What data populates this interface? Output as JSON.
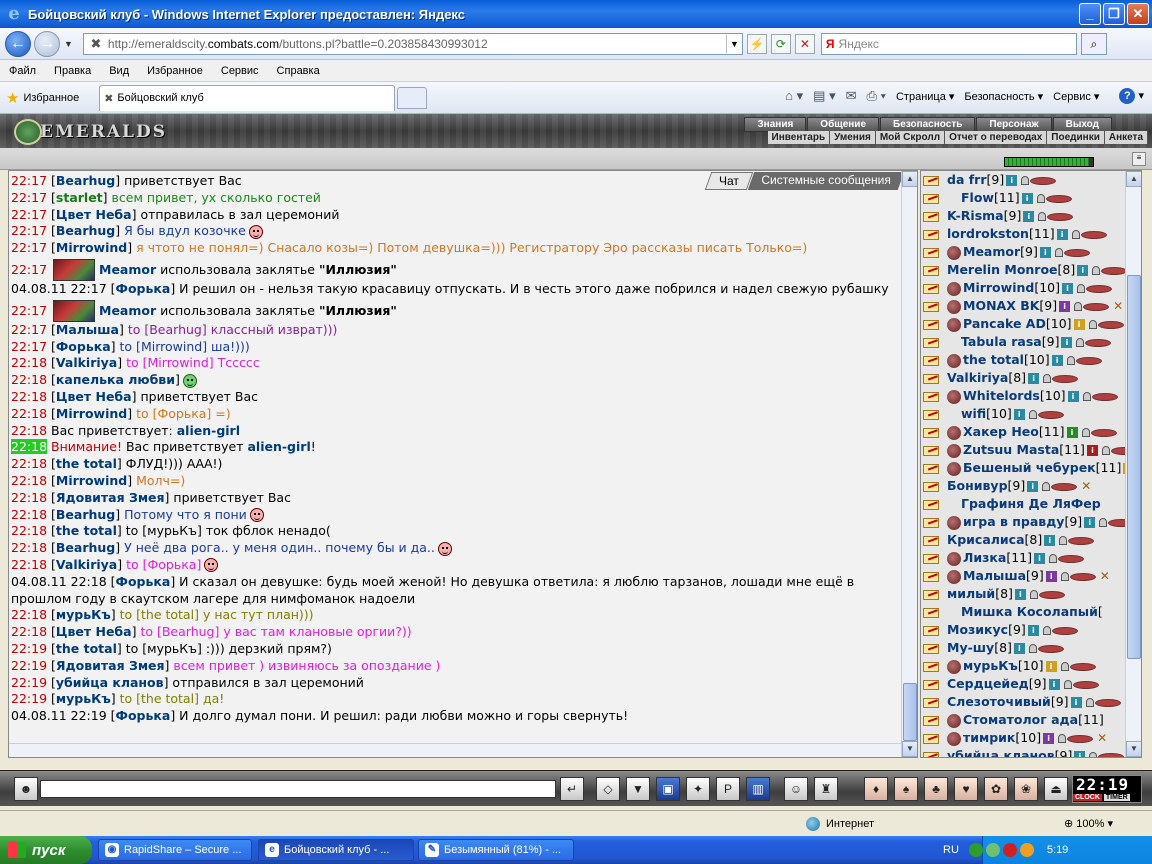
{
  "window": {
    "title": "Бойцовский клуб - Windows Internet Explorer предоставлен: Яндекс"
  },
  "address": {
    "url_prefix": "http://emeraldscity.",
    "url_domain": "combats.com",
    "url_suffix": "/buttons.pl?battle=0.203858430993012",
    "search_placeholder": "Яндекс"
  },
  "menu": [
    "Файл",
    "Правка",
    "Вид",
    "Избранное",
    "Сервис",
    "Справка"
  ],
  "favorites": {
    "label": "Избранное",
    "tab_title": "Бойцовский клуб"
  },
  "command_bar": {
    "page": "Страница ▾",
    "security": "Безопасность ▾",
    "service": "Сервис ▾"
  },
  "game": {
    "logo": "EMERALDS",
    "top_menu": [
      "Знания",
      "Общение",
      "Безопасность",
      "Персонаж",
      "Выход"
    ],
    "sub_menu": [
      "Инвентарь",
      "Умения",
      "Мой Скролл",
      "Отчет о переводах",
      "Поединки",
      "Анкета"
    ],
    "hp_percent": 95
  },
  "chat": {
    "tabs": [
      "Чат",
      "Системные сообщения"
    ],
    "lines": [
      {
        "time": "22:17",
        "nick": "Bearhug",
        "text": " приветствует Вас",
        "style": "plain",
        "type": "greet"
      },
      {
        "time": "22:17",
        "nick": "starlet",
        "text": " всем привет, ух сколько гостей",
        "style": "green",
        "type": "nick"
      },
      {
        "time": "22:17",
        "nick": "Цвет Неба",
        "text": " отправилась в зал церемоний",
        "style": "plain",
        "type": "greet"
      },
      {
        "time": "22:17",
        "nick": "Bearhug",
        "text": " Я бы вдул козочке",
        "style": "blue",
        "type": "nick",
        "smile": "pink"
      },
      {
        "time": "22:17",
        "nick": "Mirrowind",
        "text": " я чтото не понял=) Снасало козы=) Потом девушка=))) Регистратору Эро рассказы писать Только=)",
        "style": "orange",
        "type": "nick"
      },
      {
        "time": "22:17",
        "nick": "Meamor",
        "text": " использовала заклятье ",
        "bold": "\"Иллюзия\"",
        "type": "spell"
      },
      {
        "time": "04.08.11 22:17",
        "nick": "Форька",
        "text": " И решил он - нельзя такую красавицу отпускать. И в честь этого даже побрился и надел свежую рубашку",
        "style": "plain",
        "type": "wrap"
      },
      {
        "time": "22:17",
        "nick": "Meamor",
        "text": " использовала заклятье ",
        "bold": "\"Иллюзия\"",
        "type": "spell"
      },
      {
        "time": "22:17",
        "nick": "Малыша",
        "to": "Bearhug",
        "text": " классный изврат)))",
        "style": "violet",
        "type": "to"
      },
      {
        "time": "22:17",
        "nick": "Форька",
        "to": "Mirrowind",
        "text": " ша!)))",
        "style": "blue",
        "type": "to"
      },
      {
        "time": "22:18",
        "nick": "Valkiriya",
        "to": "Mirrowind",
        "text": " Тссссс",
        "style": "magenta",
        "type": "to"
      },
      {
        "time": "22:18",
        "nick": "капелька любви",
        "text": "",
        "style": "plain",
        "type": "nick",
        "smile": "green"
      },
      {
        "time": "22:18",
        "nick": "Цвет Неба",
        "text": " приветствует Вас",
        "style": "plain",
        "type": "greet"
      },
      {
        "time": "22:18",
        "nick": "Mirrowind",
        "to": "Форька",
        "text": " =)",
        "style": "orange",
        "type": "to"
      },
      {
        "time": "22:18",
        "prefix": "Вас приветствует: ",
        "name": "alien-girl",
        "type": "sys"
      },
      {
        "time": "22:18",
        "warn": "Внимание!",
        "prefix": " Вас приветствует ",
        "name": "alien-girl",
        "suffix": "!",
        "type": "warn"
      },
      {
        "time": "22:18",
        "nick": "the total",
        "text": " ФЛУД!))) ААА!)",
        "style": "plain",
        "type": "nick"
      },
      {
        "time": "22:18",
        "nick": "Mirrowind",
        "text": " Молч=)",
        "style": "orange",
        "type": "nick"
      },
      {
        "time": "22:18",
        "nick": "Ядовитая Змея",
        "text": " приветствует Вас",
        "style": "plain",
        "type": "greet"
      },
      {
        "time": "22:18",
        "nick": "Bearhug",
        "text": " Потому что я пони",
        "style": "blue",
        "type": "nick",
        "smile": "pink"
      },
      {
        "time": "22:18",
        "nick": "the total",
        "to": "мурьКъ",
        "text": " ток фблок ненадо(",
        "style": "plain",
        "type": "to"
      },
      {
        "time": "22:18",
        "nick": "Bearhug",
        "text": " У неё два рога.. у меня один.. почему бы и да..",
        "style": "blue",
        "type": "nick",
        "smile": "pink"
      },
      {
        "time": "22:18",
        "nick": "Valkiriya",
        "to": "Форька",
        "text": "",
        "style": "magenta",
        "type": "to",
        "smile": "pink"
      },
      {
        "time": "04.08.11 22:18",
        "nick": "Форька",
        "text": " И сказал он девушке: будь моей женой! Но девушка ответила: я люблю тарзанов, лошади мне ещё в прошлом году в скаутском лагере для нимфоманок надоели",
        "style": "plain",
        "type": "wrap"
      },
      {
        "time": "22:18",
        "nick": "мурьКъ",
        "to": "the total",
        "text": " у нас тут план)))",
        "style": "olive",
        "type": "to"
      },
      {
        "time": "22:18",
        "nick": "Цвет Неба",
        "to": "Bearhug",
        "text": " у вас там клановые оргии?))",
        "style": "magenta",
        "type": "to"
      },
      {
        "time": "22:19",
        "nick": "the total",
        "to": "мурьКъ",
        "text": " :))) дерзкий прям?)",
        "style": "plain",
        "type": "to"
      },
      {
        "time": "22:19",
        "nick": "Ядовитая Змея",
        "text": " всем привет ) извиняюсь за опоздание )",
        "style": "magenta",
        "type": "nick"
      },
      {
        "time": "22:19",
        "nick": "убийца кланов",
        "text": " отправился в зал церемоний",
        "style": "plain",
        "type": "greet"
      },
      {
        "time": "22:19",
        "nick": "мурьКъ",
        "to": "the total",
        "text": " да!",
        "style": "olive",
        "type": "to"
      },
      {
        "time": "04.08.11 22:19",
        "nick": "Форька",
        "text": " И долго думал пони. И решил: ради любви можно и горы свернуть!",
        "style": "plain",
        "type": "wrap"
      }
    ]
  },
  "users": [
    {
      "name": "da frr",
      "level": "[9]",
      "info": "blue"
    },
    {
      "name": "Flow",
      "level": "[11]",
      "info": "blue",
      "indent": true
    },
    {
      "name": "K-Risma",
      "level": "[9]",
      "info": "blue"
    },
    {
      "name": "lordrokston",
      "level": "[11]",
      "info": "blue"
    },
    {
      "name": "Meamor",
      "level": "[9]",
      "info": "blue",
      "clan": true
    },
    {
      "name": "Merelin Monroe",
      "level": "[8]",
      "info": "blue"
    },
    {
      "name": "Mirrowind",
      "level": "[10]",
      "info": "blue",
      "clan": true
    },
    {
      "name": "MONAX BK",
      "level": "[9]",
      "info": "violet",
      "clan": true,
      "cross": true
    },
    {
      "name": "Pancake AD",
      "level": "[10]",
      "info": "yellow",
      "clan": true
    },
    {
      "name": "Tabula rasa",
      "level": "[9]",
      "info": "blue",
      "indent": true
    },
    {
      "name": "the total",
      "level": "[10]",
      "info": "blue",
      "clan": true
    },
    {
      "name": "Valkiriya",
      "level": "[8]",
      "info": "blue"
    },
    {
      "name": "Whitelords",
      "level": "[10]",
      "info": "blue",
      "clan": true
    },
    {
      "name": "wifi",
      "level": "[10]",
      "info": "blue",
      "indent": true
    },
    {
      "name": "Хакер Нео",
      "level": "[11]",
      "info": "green",
      "clan": true
    },
    {
      "name": "Zutsuu Masta",
      "level": "[11]",
      "info": "red",
      "clan": true
    },
    {
      "name": "Бешеный чебурек",
      "level": "[11]",
      "info": "yellow",
      "clan": true
    },
    {
      "name": "Бонивур",
      "level": "[9]",
      "info": "blue",
      "cross": true
    },
    {
      "name": "Графиня Де ЛяФер",
      "level": "",
      "info": "",
      "indent": true
    },
    {
      "name": "игра в правду",
      "level": "[9]",
      "info": "blue",
      "clan": true
    },
    {
      "name": "Крисалиса",
      "level": "[8]",
      "info": "blue"
    },
    {
      "name": "Лизка",
      "level": "[11]",
      "info": "blue",
      "clan": true
    },
    {
      "name": "Малыша",
      "level": "[9]",
      "info": "violet",
      "clan": true,
      "cross": true
    },
    {
      "name": "милый",
      "level": "[8]",
      "info": "blue"
    },
    {
      "name": "Мишка Косолапый",
      "level": "[",
      "info": "",
      "indent": true
    },
    {
      "name": "Мозикус",
      "level": "[9]",
      "info": "blue"
    },
    {
      "name": "Му-шу",
      "level": "[8]",
      "info": "blue"
    },
    {
      "name": "мурьКъ",
      "level": "[10]",
      "info": "yellow",
      "clan": true
    },
    {
      "name": "Сердцейед",
      "level": "[9]",
      "info": "blue"
    },
    {
      "name": "Слезоточивый",
      "level": "[9]",
      "info": "blue"
    },
    {
      "name": "Стоматолог ада",
      "level": "[11]",
      "info": "",
      "clan": true
    },
    {
      "name": "тимрик",
      "level": "[10]",
      "info": "violet",
      "clan": true,
      "cross": true
    },
    {
      "name": "убийца кланов",
      "level": "[9]",
      "info": "blue"
    }
  ],
  "clock": {
    "time": "22:19",
    "label_clock": "CLOCK",
    "label_timer": "TIMER"
  },
  "statusbar": {
    "zone": "Интернет",
    "zoom": "100%"
  },
  "taskbar": {
    "start": "пуск",
    "tasks": [
      "RapidShare – Secure ...",
      "Бойцовский клуб - ...",
      "Безымянный (81%) - ..."
    ],
    "lang": "RU",
    "time": "5:19"
  }
}
